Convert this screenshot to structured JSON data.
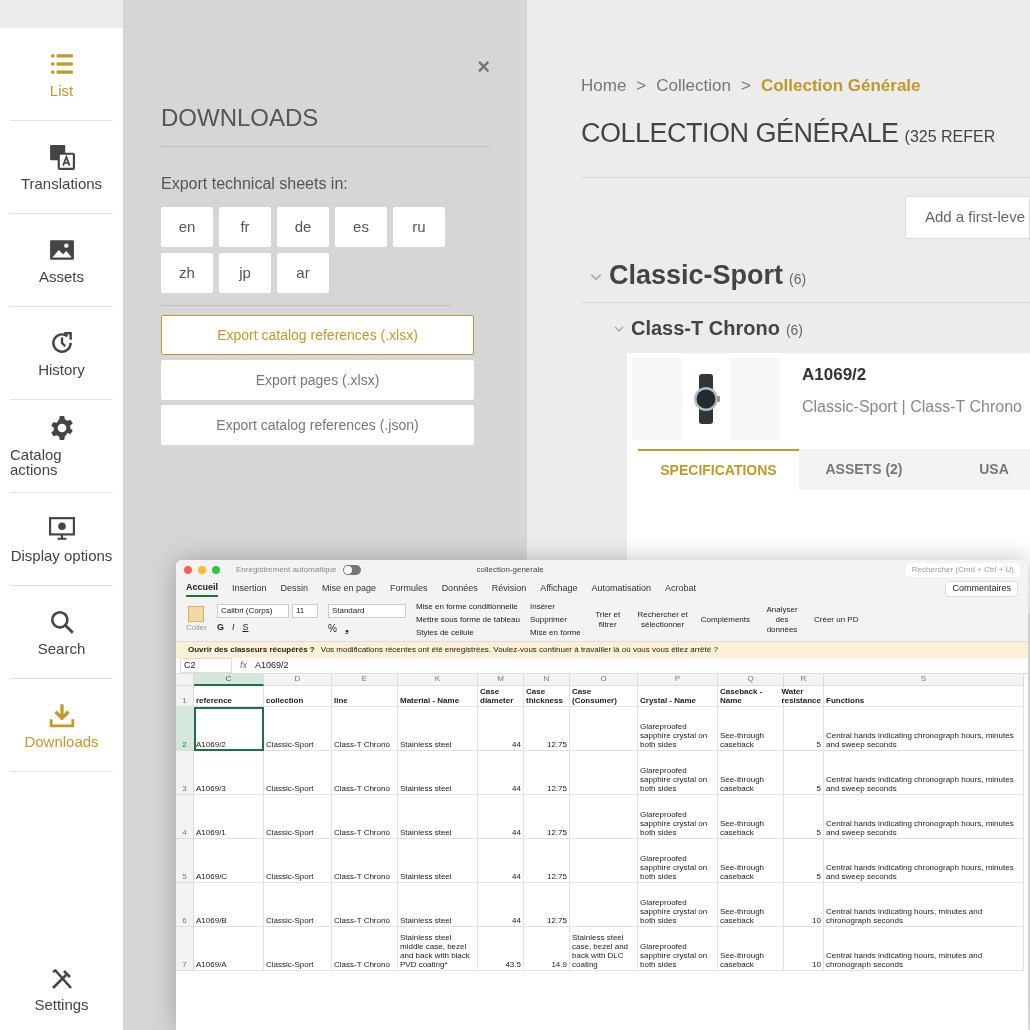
{
  "sidebar": {
    "items": [
      {
        "label": "List",
        "selected": true
      },
      {
        "label": "Translations",
        "selected": false
      },
      {
        "label": "Assets",
        "selected": false
      },
      {
        "label": "History",
        "selected": false
      },
      {
        "label": "Catalog actions",
        "selected": false
      },
      {
        "label": "Display options",
        "selected": false
      },
      {
        "label": "Search",
        "selected": false
      },
      {
        "label": "Downloads",
        "selected": true
      }
    ],
    "settings": {
      "label": "Settings"
    }
  },
  "downloads_panel": {
    "close": "×",
    "title": "DOWNLOADS",
    "prompt": "Export technical sheets in:",
    "languages": [
      "en",
      "fr",
      "de",
      "es",
      "ru",
      "zh",
      "jp",
      "ar"
    ],
    "exports": [
      {
        "label": "Export catalog references (.xlsx)",
        "highlighted": true
      },
      {
        "label": "Export pages (.xlsx)",
        "highlighted": false
      },
      {
        "label": "Export catalog references (.json)",
        "highlighted": false
      }
    ]
  },
  "main": {
    "breadcrumb": [
      {
        "label": "Home",
        "current": false
      },
      {
        "label": "Collection",
        "current": false
      },
      {
        "label": "Collection Générale",
        "current": true
      }
    ],
    "breadcrumb_separator": ">",
    "title": "COLLECTION GÉNÉRALE",
    "count": "(325 REFER",
    "add_button": "Add a first-leve",
    "group": {
      "name": "Classic-Sport",
      "count": "(6)",
      "expanded": true
    },
    "subgroup": {
      "name": "Class-T Chrono",
      "count": "(6)",
      "expanded": true
    },
    "product": {
      "reference": "A1069/2",
      "path": "Classic-Sport | Class-T Chrono",
      "tabs": [
        {
          "label": "SPECIFICATIONS",
          "selected": true
        },
        {
          "label": "ASSETS (2)",
          "selected": false
        },
        {
          "label": "USA",
          "selected": false
        }
      ]
    }
  },
  "spreadsheet": {
    "autosave": "Enregistrement automatique",
    "autosave_on": false,
    "file": "collection-generale",
    "search": "Rechercher (Cmd + Ctrl + U)",
    "comments": "Commentaires",
    "tabs": [
      {
        "label": "Accueil",
        "selected": true
      },
      {
        "label": "Insertion",
        "selected": false
      },
      {
        "label": "Dessin",
        "selected": false
      },
      {
        "label": "Mise en page",
        "selected": false
      },
      {
        "label": "Formules",
        "selected": false
      },
      {
        "label": "Données",
        "selected": false
      },
      {
        "label": "Révision",
        "selected": false
      },
      {
        "label": "Affichage",
        "selected": false
      },
      {
        "label": "Automatisation",
        "selected": false
      },
      {
        "label": "Acrobat",
        "selected": false
      }
    ],
    "paste": "Coller",
    "font": "Calibri (Corps)",
    "font_size": "11",
    "bold": "G",
    "italic": "I",
    "underline": "S",
    "number_format": "Standard",
    "percent": "%",
    "thousands": "❟",
    "styles": [
      "Mise en forme conditionnelle",
      "Mettre sous forme de tableau",
      "Styles de cellule"
    ],
    "cells": [
      "Insérer",
      "Supprimer",
      "Mise en forme"
    ],
    "sort": "Trier et filtrer",
    "find": "Rechercher et sélectionner",
    "addins": "Compléments",
    "analyze": "Analyser des données",
    "pdf": "Créer un PD",
    "notice_title": "Ouvrir des classeurs récupérés ?",
    "notice": "Vos modifications récentes ont été enregistrées. Voulez-vous continuer à travailler là où vous vous étiez arrêté ?",
    "name_box": "C2",
    "fx": "fx",
    "formula": "A1069/2",
    "columns": [
      {
        "label": "C",
        "selected": true
      },
      {
        "label": "D",
        "selected": false
      },
      {
        "label": "E",
        "selected": false
      },
      {
        "label": "K",
        "selected": false
      },
      {
        "label": "M",
        "selected": false
      },
      {
        "label": "N",
        "selected": false
      },
      {
        "label": "O",
        "selected": false
      },
      {
        "label": "P",
        "selected": false
      },
      {
        "label": "Q",
        "selected": false
      },
      {
        "label": "R",
        "selected": false
      },
      {
        "label": "S",
        "selected": false
      }
    ],
    "rows": [
      {
        "number": "1",
        "selected": false,
        "cells": [
          "reference",
          "collection",
          "line",
          "Material - Name",
          "Case diameter",
          "Case thickness",
          "Case (Consumer)",
          "Crystal - Name",
          "Caseback - Name",
          "Water resistance",
          "Functions"
        ]
      },
      {
        "number": "2",
        "selected": true,
        "cells": [
          "A1069/2",
          "Classic-Sport",
          "Class-T Chrono",
          "Stainless steel",
          "44",
          "12.75",
          "",
          "Glareproofed sapphire crystal on both sides",
          "See-through caseback",
          "5",
          "Central hands indicating chronograph hours, minutes and sweep seconds"
        ]
      },
      {
        "number": "3",
        "selected": false,
        "cells": [
          "A1069/3",
          "Classic-Sport",
          "Class-T Chrono",
          "Stainless steel",
          "44",
          "12.75",
          "",
          "Glareproofed sapphire crystal on both sides",
          "See-through caseback",
          "5",
          "Central hands indicating chronograph hours, minutes and sweep seconds"
        ]
      },
      {
        "number": "4",
        "selected": false,
        "cells": [
          "A1069/1",
          "Classic-Sport",
          "Class-T Chrono",
          "Stainless steel",
          "44",
          "12.75",
          "",
          "Glareproofed sapphire crystal on both sides",
          "See-through caseback",
          "5",
          "Central hands indicating chronograph hours, minutes and sweep seconds"
        ]
      },
      {
        "number": "5",
        "selected": false,
        "cells": [
          "A1069/C",
          "Classic-Sport",
          "Class-T Chrono",
          "Stainless steel",
          "44",
          "12.75",
          "",
          "Glareproofed sapphire crystal on both sides",
          "See-through caseback",
          "5",
          "Central hands indicating chronograph hours, minutes and sweep seconds"
        ]
      },
      {
        "number": "6",
        "selected": false,
        "cells": [
          "A1069/B",
          "Classic-Sport",
          "Class-T Chrono",
          "Stainless steel",
          "44",
          "12.75",
          "",
          "Glareproofed sapphire crystal on both sides",
          "See-through caseback",
          "10",
          "Central hands indicating hours, minutes and chronograph seconds"
        ]
      },
      {
        "number": "7",
        "selected": false,
        "cells": [
          "A1069/A",
          "Classic-Sport",
          "Class-T Chrono",
          "Stainless steel middle case, bezel and back with black PVD coating*",
          "43.5",
          "14.9",
          "Stainless steel case, bezel and back with DLC coating",
          "Glareproofed sapphire crystal on both sides",
          "See-through caseback",
          "10",
          "Central hands indicating hours, minutes and chronograph seconds"
        ]
      }
    ]
  }
}
